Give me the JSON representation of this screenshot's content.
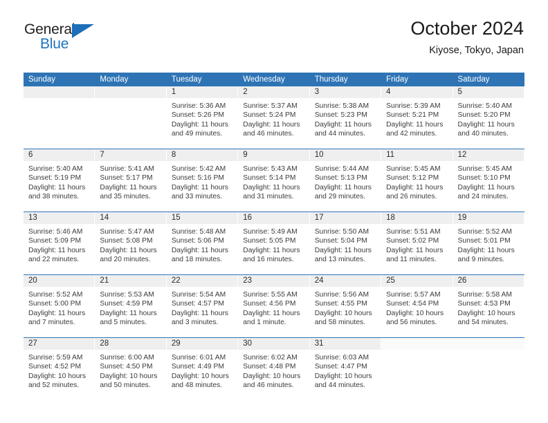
{
  "brand": {
    "line1": "General",
    "line2": "Blue",
    "flag_icon": "triangle-flag-icon",
    "accent_color": "#1c6fb8"
  },
  "header": {
    "title": "October 2024",
    "subtitle": "Kiyose, Tokyo, Japan"
  },
  "calendar": {
    "header_color": "#2e74b5",
    "datebar_color": "#efefef",
    "weekday_headers": [
      "Sunday",
      "Monday",
      "Tuesday",
      "Wednesday",
      "Thursday",
      "Friday",
      "Saturday"
    ],
    "weeks": [
      [
        {
          "date": "",
          "lines": []
        },
        {
          "date": "",
          "lines": []
        },
        {
          "date": "1",
          "lines": [
            "Sunrise: 5:36 AM",
            "Sunset: 5:26 PM",
            "Daylight: 11 hours",
            "and 49 minutes."
          ]
        },
        {
          "date": "2",
          "lines": [
            "Sunrise: 5:37 AM",
            "Sunset: 5:24 PM",
            "Daylight: 11 hours",
            "and 46 minutes."
          ]
        },
        {
          "date": "3",
          "lines": [
            "Sunrise: 5:38 AM",
            "Sunset: 5:23 PM",
            "Daylight: 11 hours",
            "and 44 minutes."
          ]
        },
        {
          "date": "4",
          "lines": [
            "Sunrise: 5:39 AM",
            "Sunset: 5:21 PM",
            "Daylight: 11 hours",
            "and 42 minutes."
          ]
        },
        {
          "date": "5",
          "lines": [
            "Sunrise: 5:40 AM",
            "Sunset: 5:20 PM",
            "Daylight: 11 hours",
            "and 40 minutes."
          ]
        }
      ],
      [
        {
          "date": "6",
          "lines": [
            "Sunrise: 5:40 AM",
            "Sunset: 5:19 PM",
            "Daylight: 11 hours",
            "and 38 minutes."
          ]
        },
        {
          "date": "7",
          "lines": [
            "Sunrise: 5:41 AM",
            "Sunset: 5:17 PM",
            "Daylight: 11 hours",
            "and 35 minutes."
          ]
        },
        {
          "date": "8",
          "lines": [
            "Sunrise: 5:42 AM",
            "Sunset: 5:16 PM",
            "Daylight: 11 hours",
            "and 33 minutes."
          ]
        },
        {
          "date": "9",
          "lines": [
            "Sunrise: 5:43 AM",
            "Sunset: 5:14 PM",
            "Daylight: 11 hours",
            "and 31 minutes."
          ]
        },
        {
          "date": "10",
          "lines": [
            "Sunrise: 5:44 AM",
            "Sunset: 5:13 PM",
            "Daylight: 11 hours",
            "and 29 minutes."
          ]
        },
        {
          "date": "11",
          "lines": [
            "Sunrise: 5:45 AM",
            "Sunset: 5:12 PM",
            "Daylight: 11 hours",
            "and 26 minutes."
          ]
        },
        {
          "date": "12",
          "lines": [
            "Sunrise: 5:45 AM",
            "Sunset: 5:10 PM",
            "Daylight: 11 hours",
            "and 24 minutes."
          ]
        }
      ],
      [
        {
          "date": "13",
          "lines": [
            "Sunrise: 5:46 AM",
            "Sunset: 5:09 PM",
            "Daylight: 11 hours",
            "and 22 minutes."
          ]
        },
        {
          "date": "14",
          "lines": [
            "Sunrise: 5:47 AM",
            "Sunset: 5:08 PM",
            "Daylight: 11 hours",
            "and 20 minutes."
          ]
        },
        {
          "date": "15",
          "lines": [
            "Sunrise: 5:48 AM",
            "Sunset: 5:06 PM",
            "Daylight: 11 hours",
            "and 18 minutes."
          ]
        },
        {
          "date": "16",
          "lines": [
            "Sunrise: 5:49 AM",
            "Sunset: 5:05 PM",
            "Daylight: 11 hours",
            "and 16 minutes."
          ]
        },
        {
          "date": "17",
          "lines": [
            "Sunrise: 5:50 AM",
            "Sunset: 5:04 PM",
            "Daylight: 11 hours",
            "and 13 minutes."
          ]
        },
        {
          "date": "18",
          "lines": [
            "Sunrise: 5:51 AM",
            "Sunset: 5:02 PM",
            "Daylight: 11 hours",
            "and 11 minutes."
          ]
        },
        {
          "date": "19",
          "lines": [
            "Sunrise: 5:52 AM",
            "Sunset: 5:01 PM",
            "Daylight: 11 hours",
            "and 9 minutes."
          ]
        }
      ],
      [
        {
          "date": "20",
          "lines": [
            "Sunrise: 5:52 AM",
            "Sunset: 5:00 PM",
            "Daylight: 11 hours",
            "and 7 minutes."
          ]
        },
        {
          "date": "21",
          "lines": [
            "Sunrise: 5:53 AM",
            "Sunset: 4:59 PM",
            "Daylight: 11 hours",
            "and 5 minutes."
          ]
        },
        {
          "date": "22",
          "lines": [
            "Sunrise: 5:54 AM",
            "Sunset: 4:57 PM",
            "Daylight: 11 hours",
            "and 3 minutes."
          ]
        },
        {
          "date": "23",
          "lines": [
            "Sunrise: 5:55 AM",
            "Sunset: 4:56 PM",
            "Daylight: 11 hours",
            "and 1 minute."
          ]
        },
        {
          "date": "24",
          "lines": [
            "Sunrise: 5:56 AM",
            "Sunset: 4:55 PM",
            "Daylight: 10 hours",
            "and 58 minutes."
          ]
        },
        {
          "date": "25",
          "lines": [
            "Sunrise: 5:57 AM",
            "Sunset: 4:54 PM",
            "Daylight: 10 hours",
            "and 56 minutes."
          ]
        },
        {
          "date": "26",
          "lines": [
            "Sunrise: 5:58 AM",
            "Sunset: 4:53 PM",
            "Daylight: 10 hours",
            "and 54 minutes."
          ]
        }
      ],
      [
        {
          "date": "27",
          "lines": [
            "Sunrise: 5:59 AM",
            "Sunset: 4:52 PM",
            "Daylight: 10 hours",
            "and 52 minutes."
          ]
        },
        {
          "date": "28",
          "lines": [
            "Sunrise: 6:00 AM",
            "Sunset: 4:50 PM",
            "Daylight: 10 hours",
            "and 50 minutes."
          ]
        },
        {
          "date": "29",
          "lines": [
            "Sunrise: 6:01 AM",
            "Sunset: 4:49 PM",
            "Daylight: 10 hours",
            "and 48 minutes."
          ]
        },
        {
          "date": "30",
          "lines": [
            "Sunrise: 6:02 AM",
            "Sunset: 4:48 PM",
            "Daylight: 10 hours",
            "and 46 minutes."
          ]
        },
        {
          "date": "31",
          "lines": [
            "Sunrise: 6:03 AM",
            "Sunset: 4:47 PM",
            "Daylight: 10 hours",
            "and 44 minutes."
          ]
        },
        {
          "date": "",
          "lines": []
        },
        {
          "date": "",
          "lines": []
        }
      ]
    ]
  }
}
